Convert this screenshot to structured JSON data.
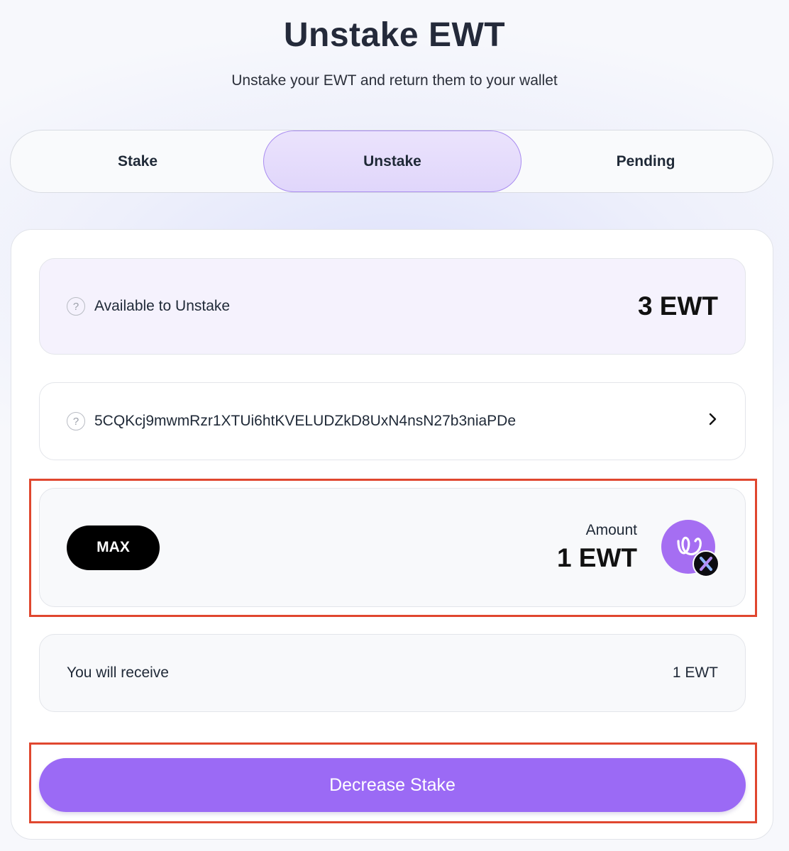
{
  "header": {
    "title": "Unstake EWT",
    "subtitle": "Unstake your EWT and return them to your wallet"
  },
  "tabs": [
    {
      "label": "Stake",
      "active": false
    },
    {
      "label": "Unstake",
      "active": true
    },
    {
      "label": "Pending",
      "active": false
    }
  ],
  "available": {
    "label": "Available to Unstake",
    "value": "3 EWT"
  },
  "validator": {
    "address": "5CQKcj9mwmRzr1XTUi6htKVELUDZkD8UxN4nsN27b3niaPDe"
  },
  "amount": {
    "max_label": "MAX",
    "label": "Amount",
    "value": "1 EWT",
    "token_icon": "ewt-token-icon",
    "badge_icon": "x-badge-icon"
  },
  "receive": {
    "label": "You will receive",
    "value": "1 EWT"
  },
  "submit": {
    "label": "Decrease Stake"
  },
  "colors": {
    "accent": "#9b6af5",
    "highlight": "#e0472f"
  }
}
